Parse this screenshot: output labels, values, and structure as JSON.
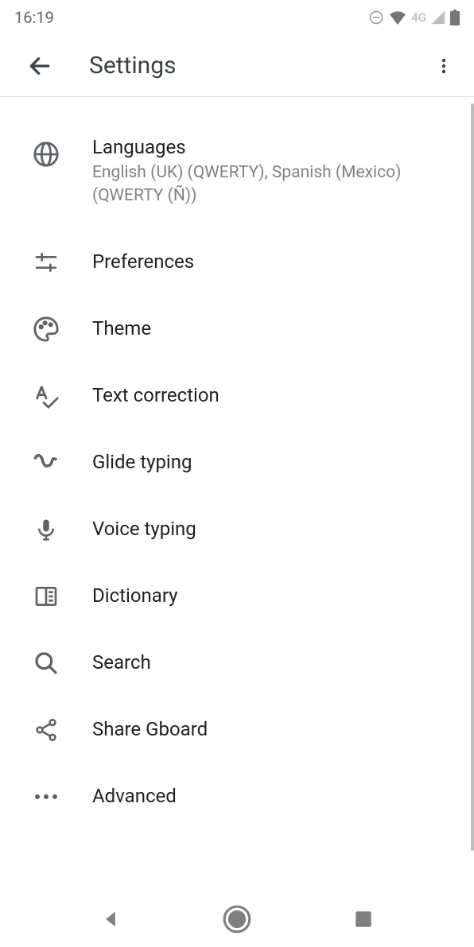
{
  "status": {
    "time": "16:19",
    "network_label": "4G"
  },
  "header": {
    "title": "Settings"
  },
  "items": {
    "languages": {
      "title": "Languages",
      "subtitle": "English (UK) (QWERTY), Spanish (Mexico) (QWERTY (Ñ))"
    },
    "preferences": {
      "title": "Preferences"
    },
    "theme": {
      "title": "Theme"
    },
    "text_correction": {
      "title": "Text correction"
    },
    "glide_typing": {
      "title": "Glide typing"
    },
    "voice_typing": {
      "title": "Voice typing"
    },
    "dictionary": {
      "title": "Dictionary"
    },
    "search": {
      "title": "Search"
    },
    "share": {
      "title": "Share Gboard"
    },
    "advanced": {
      "title": "Advanced"
    }
  }
}
